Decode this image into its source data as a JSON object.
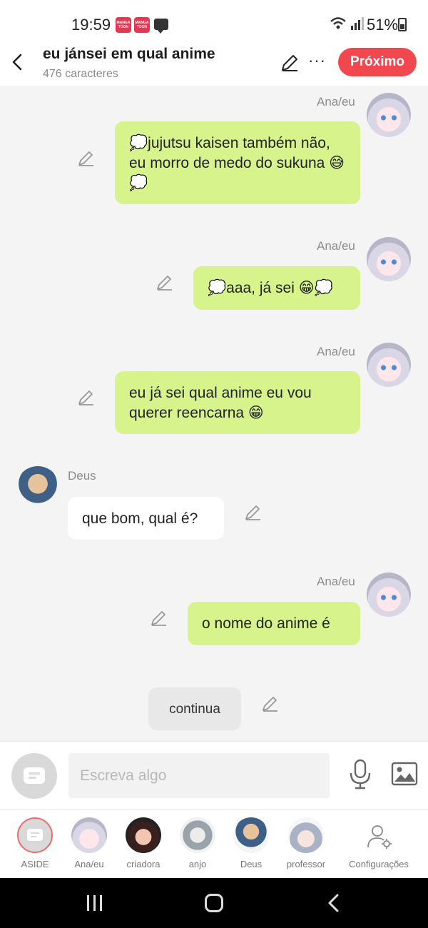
{
  "status_bar": {
    "time": "19:59",
    "app_icon_label": "MANGA TOON",
    "battery": "51%"
  },
  "header": {
    "title": "eu jánsei em qual anime",
    "subtitle": "476 caracteres",
    "more_label": "···",
    "next_label": "Próximo"
  },
  "messages": [
    {
      "sender": "Ana/eu",
      "side": "right",
      "text": "💭jujutsu kaisen também não, eu morro de medo do sukuna 😅💭"
    },
    {
      "sender": "Ana/eu",
      "side": "right",
      "text": "💭aaa, já sei 😁💭"
    },
    {
      "sender": "Ana/eu",
      "side": "right",
      "text": "eu já sei qual anime eu vou querer reencarna 😁"
    },
    {
      "sender": "Deus",
      "side": "left",
      "text": "que bom, qual é?"
    },
    {
      "sender": "Ana/eu",
      "side": "right",
      "text": "o nome do anime é"
    },
    {
      "sender": "",
      "side": "center",
      "text": "continua"
    }
  ],
  "composer": {
    "placeholder": "Escreva algo"
  },
  "characters": [
    {
      "label": "ASIDE"
    },
    {
      "label": "Ana/eu"
    },
    {
      "label": "criadora"
    },
    {
      "label": "anjo"
    },
    {
      "label": "Deus"
    },
    {
      "label": "professor"
    },
    {
      "label": "Configurações"
    }
  ],
  "colors": {
    "accent": "#f2474f",
    "my_bubble": "#d6f48b",
    "other_bubble": "#ffffff",
    "background": "#f4f4f4"
  }
}
